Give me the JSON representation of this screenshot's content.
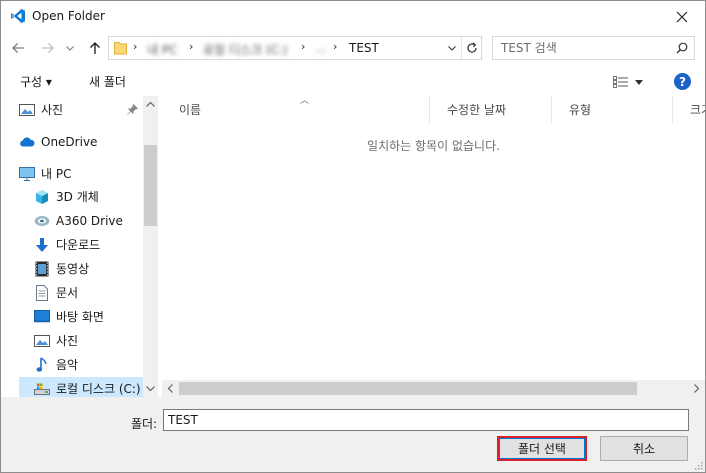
{
  "window": {
    "title": "Open Folder",
    "app_icon": "vscode-icon",
    "close_icon": "close-icon"
  },
  "nav": {
    "back_icon": "back-arrow-icon",
    "forward_icon": "forward-arrow-icon",
    "recent_icon": "chevron-down-icon",
    "up_icon": "up-arrow-icon",
    "breadcrumbs": [
      {
        "label": "내 PC",
        "blurred": true
      },
      {
        "label": "로컬 디스크 (C:)",
        "blurred": true
      },
      {
        "label": "...",
        "blurred": true
      },
      {
        "label": "TEST",
        "blurred": false
      }
    ],
    "refresh_icon": "refresh-icon"
  },
  "search": {
    "placeholder": "TEST 검색",
    "icon": "search-icon"
  },
  "toolbar": {
    "organize_label": "구성 ▾",
    "new_folder_label": "새 폴더",
    "view_icon": "view-options-icon",
    "help_label": "?"
  },
  "sidebar": {
    "items": [
      {
        "label": "사진",
        "icon": "pictures-icon",
        "pinned": true
      },
      {
        "label": "OneDrive",
        "icon": "cloud-icon"
      },
      {
        "label": "내 PC",
        "icon": "computer-icon"
      },
      {
        "label": "3D 개체",
        "icon": "3d-objects-icon"
      },
      {
        "label": "A360 Drive",
        "icon": "a360-drive-icon"
      },
      {
        "label": "다운로드",
        "icon": "download-icon"
      },
      {
        "label": "동영상",
        "icon": "video-icon"
      },
      {
        "label": "문서",
        "icon": "document-icon"
      },
      {
        "label": "바탕 화면",
        "icon": "desktop-icon"
      },
      {
        "label": "사진",
        "icon": "pictures-icon"
      },
      {
        "label": "음악",
        "icon": "music-icon"
      },
      {
        "label": "로컬 디스크 (C:)",
        "icon": "drive-icon",
        "selected": true
      }
    ]
  },
  "filelist": {
    "columns": [
      "이름",
      "수정한 날짜",
      "유형",
      "크기"
    ],
    "empty_message": "일치하는 항목이 없습니다."
  },
  "footer": {
    "folder_label": "폴더:",
    "folder_value": "TEST",
    "select_button": "폴더 선택",
    "cancel_button": "취소"
  },
  "colors": {
    "accent": "#0078d7",
    "highlight_border": "#d6222a",
    "selection": "#cce8ff"
  }
}
